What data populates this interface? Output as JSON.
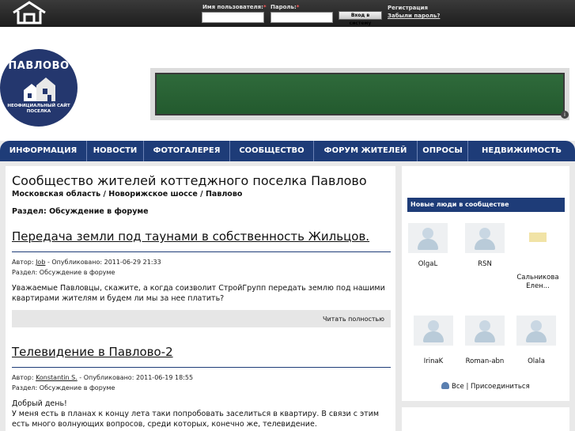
{
  "topbar": {
    "username_label": "Имя пользователя:",
    "password_label": "Пароль:",
    "required_mark": "*",
    "login_button": "Вход в систему",
    "register_link": "Регистрация",
    "forgot_link": "Забыли пароль?"
  },
  "logo": {
    "title": "ПАВЛОВО",
    "subtitle": "НЕОФИЦИАЛЬНЫЙ САЙТ ПОСЕЛКА"
  },
  "nav": {
    "items": [
      "ИНФОРМАЦИЯ",
      "НОВОСТИ",
      "ФОТОГАЛЕРЕЯ",
      "СООБЩЕСТВО",
      "ФОРУМ ЖИТЕЛЕЙ",
      "ОПРОСЫ",
      "НЕДВИЖИМОСТЬ"
    ]
  },
  "main": {
    "title": "Сообщество жителей коттеджного поселка Павлово",
    "breadcrumb": [
      "Московская область",
      "Новорижское шоссе",
      "Павлово"
    ],
    "breadcrumb_sep": " / ",
    "section_label": "Раздел: Обсуждение в форуме",
    "articles": [
      {
        "title": "Передача земли под таунами в собственность Жильцов.",
        "author_label": "Автор:",
        "author": "Job",
        "published": "- Опубликовано: 2011-06-29 21:33",
        "section": "Раздел: Обсуждение в форуме",
        "body": "Уважаемые Павловцы, скажите, а когда соизволит СтройГрупп передать землю под нашими квартирами жителям и будем ли мы за нее платить?",
        "read_more": "Читать полностью"
      },
      {
        "title": "Телевидение в Павлово-2",
        "author_label": "Автор:",
        "author": "Konstantin S.",
        "published": "- Опубликовано: 2011-06-19 18:55",
        "section": "Раздел: Обсуждение в форуме",
        "body_line1": "Добрый день!",
        "body_line2": "У меня есть в планах к концу лета таки попробовать заселиться в квартиру. В связи с этим есть много волнующих вопросов, среди которых, конечно же, телевидение."
      }
    ]
  },
  "sidebar": {
    "heading": "Новые люди в сообществе",
    "members": [
      "OlgaL",
      "RSN",
      "Сальникова Елен...",
      "IrinaK",
      "Roman-abn",
      "Olala"
    ],
    "all_link": "Все",
    "join_link": "Присоединиться",
    "link_sep": " | "
  },
  "colors": {
    "brand_blue": "#1e3c78",
    "topbar": "#2a2a2a",
    "board_green": "#2f6a3b"
  }
}
